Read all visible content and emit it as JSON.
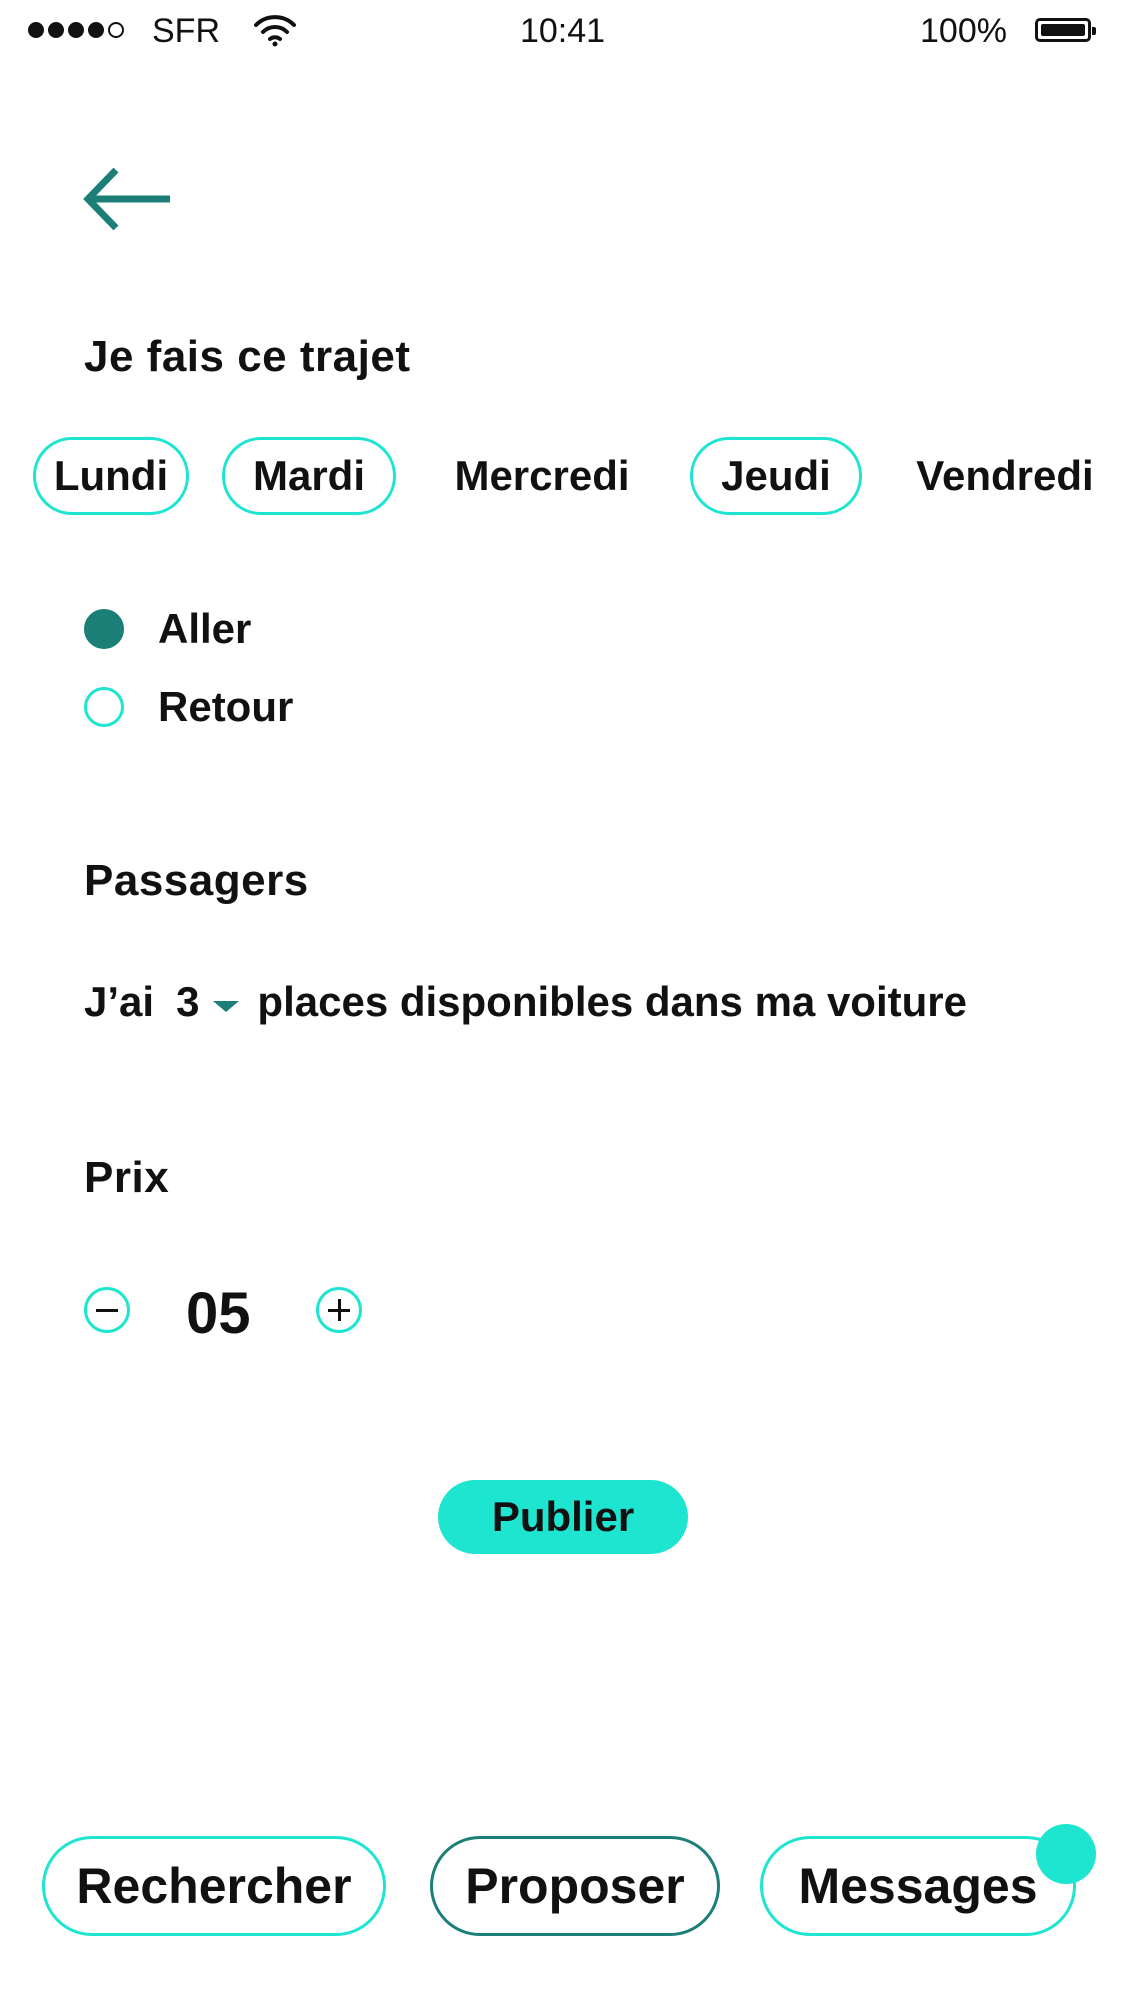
{
  "status_bar": {
    "carrier": "SFR",
    "time": "10:41",
    "battery_percent": "100%",
    "signal_bars": 4
  },
  "header": {
    "back_icon": "arrow-left-icon",
    "title": "Je fais ce trajet"
  },
  "days": [
    {
      "label": "Lundi",
      "selected": true
    },
    {
      "label": "Mardi",
      "selected": true
    },
    {
      "label": "Mercredi",
      "selected": false
    },
    {
      "label": "Jeudi",
      "selected": true
    },
    {
      "label": "Vendredi",
      "selected": false
    }
  ],
  "direction": {
    "options": [
      {
        "label": "Aller",
        "checked": true
      },
      {
        "label": "Retour",
        "checked": false
      }
    ]
  },
  "passengers": {
    "title": "Passagers",
    "prefix": "J’ai",
    "seats": "3",
    "suffix": "places disponibles dans ma voiture"
  },
  "price": {
    "title": "Prix",
    "value": "05"
  },
  "publish_label": "Publier",
  "bottom_nav": {
    "items": [
      {
        "label": "Rechercher",
        "active": false
      },
      {
        "label": "Proposer",
        "active": true
      },
      {
        "label": "Messages",
        "active": false,
        "has_notification": true
      }
    ]
  },
  "colors": {
    "accent": "#1de5d0",
    "dark_teal": "#1b7f78"
  }
}
